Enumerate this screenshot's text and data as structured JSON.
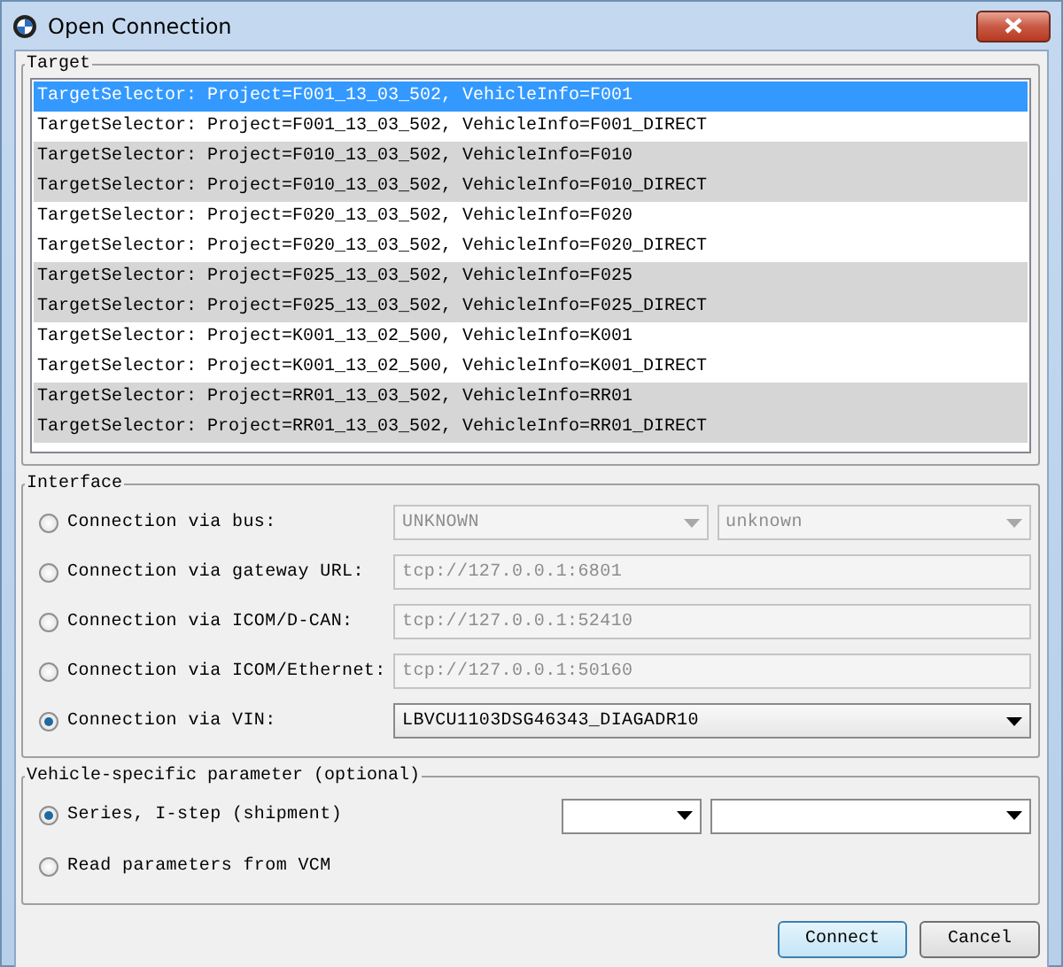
{
  "window": {
    "title": "Open Connection"
  },
  "target": {
    "title": "Target",
    "rows": [
      {
        "text": "TargetSelector: Project=F001_13_03_502,  VehicleInfo=F001",
        "selected": true
      },
      {
        "text": "TargetSelector: Project=F001_13_03_502,  VehicleInfo=F001_DIRECT",
        "selected": false
      },
      {
        "text": "TargetSelector: Project=F010_13_03_502,  VehicleInfo=F010",
        "selected": false
      },
      {
        "text": "TargetSelector: Project=F010_13_03_502,  VehicleInfo=F010_DIRECT",
        "selected": false
      },
      {
        "text": "TargetSelector: Project=F020_13_03_502,  VehicleInfo=F020",
        "selected": false
      },
      {
        "text": "TargetSelector: Project=F020_13_03_502,  VehicleInfo=F020_DIRECT",
        "selected": false
      },
      {
        "text": "TargetSelector: Project=F025_13_03_502,  VehicleInfo=F025",
        "selected": false
      },
      {
        "text": "TargetSelector: Project=F025_13_03_502,  VehicleInfo=F025_DIRECT",
        "selected": false
      },
      {
        "text": "TargetSelector: Project=K001_13_02_500,  VehicleInfo=K001",
        "selected": false
      },
      {
        "text": "TargetSelector: Project=K001_13_02_500,  VehicleInfo=K001_DIRECT",
        "selected": false
      },
      {
        "text": "TargetSelector: Project=RR01_13_03_502,  VehicleInfo=RR01",
        "selected": false
      },
      {
        "text": "TargetSelector: Project=RR01_13_03_502,  VehicleInfo=RR01_DIRECT",
        "selected": false
      }
    ]
  },
  "interface": {
    "title": "Interface",
    "options": [
      {
        "label": "Connection via bus:",
        "selected": false,
        "controls": [
          {
            "kind": "combo",
            "value": "UNKNOWN",
            "disabled": true
          },
          {
            "kind": "combo",
            "value": "unknown",
            "disabled": true
          }
        ]
      },
      {
        "label": "Connection via gateway URL:",
        "selected": false,
        "controls": [
          {
            "kind": "field",
            "value": "tcp://127.0.0.1:6801",
            "disabled": true
          }
        ]
      },
      {
        "label": "Connection via ICOM/D-CAN:",
        "selected": false,
        "controls": [
          {
            "kind": "field",
            "value": "tcp://127.0.0.1:52410",
            "disabled": true
          }
        ]
      },
      {
        "label": "Connection via ICOM/Ethernet:",
        "selected": false,
        "controls": [
          {
            "kind": "field",
            "value": "tcp://127.0.0.1:50160",
            "disabled": true
          }
        ]
      },
      {
        "label": "Connection via VIN:",
        "selected": true,
        "controls": [
          {
            "kind": "combo",
            "value": "LBVCU1103DSG46343_DIAGADR10",
            "disabled": false
          }
        ]
      }
    ]
  },
  "vehicle": {
    "title": "Vehicle-specific parameter (optional)",
    "options": [
      {
        "label": "Series, I-step (shipment)",
        "selected": true,
        "controls": [
          {
            "kind": "combo",
            "disabled": false
          },
          {
            "kind": "combo",
            "disabled": false
          }
        ]
      },
      {
        "label": "Read parameters from VCM",
        "selected": false
      }
    ]
  },
  "buttons": [
    {
      "label": "Connect",
      "default": true
    },
    {
      "label": "Cancel",
      "default": false
    }
  ]
}
